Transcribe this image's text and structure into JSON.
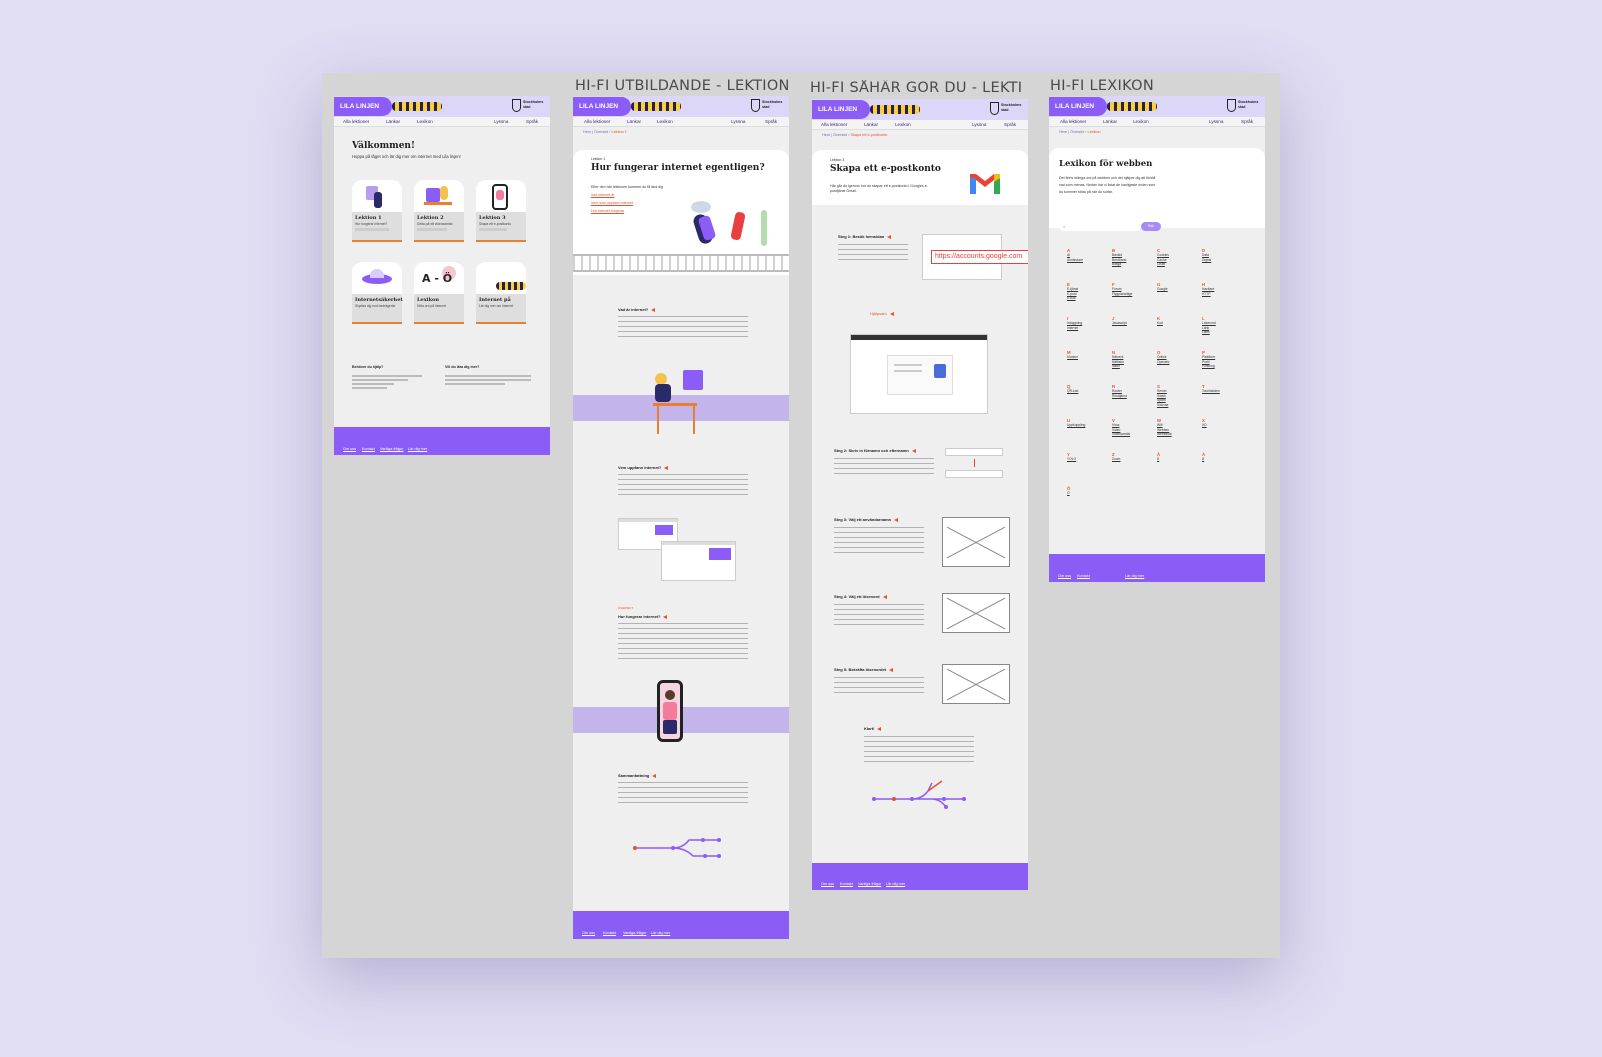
{
  "frame_titles": {
    "lektion": "HI-FI UTBILDANDE - LEKTION",
    "sahar": "HI-FI SÅHÄR GÖR DU - LEKTI...",
    "lexikon": "HI-FI LEXIKON"
  },
  "header": {
    "logo": "LILA LINJEN",
    "crest": "Stockholms stad"
  },
  "nav": {
    "lessons": "Alla lektioner",
    "links": "Länkar",
    "lexicon": "Lexikon",
    "listen": "Lyssna",
    "language": "Språk"
  },
  "home": {
    "title": "Välkommen!",
    "subtitle": "Hoppa på tåget och lär dig mer om internet med Lila linjen!",
    "cards": [
      {
        "title": "Lektion 1",
        "sub": "Hur fungerar internet?"
      },
      {
        "title": "Lektion 2",
        "sub": "Delta på ett videosamtal"
      },
      {
        "title": "Lektion 3",
        "sub": "Skapa ett e-postkonto"
      },
      {
        "title": "Internetsäkerhet",
        "sub": "Skydda dig mot bedrägerier"
      },
      {
        "title": "Lexikon",
        "sub": "Hitta ord på internet",
        "art": "A - Ö"
      },
      {
        "title": "Internet på",
        "sub": "Lär dig mer om internet"
      }
    ],
    "help_title": "Behöver du hjälp?",
    "about_title": "Vill du lära dig mer?"
  },
  "footer": {
    "om": "Om oss",
    "kontakt": "Kontakt",
    "questions": "Vanliga frågor",
    "path": "Lär dig mer"
  },
  "lektion": {
    "crumb": [
      "Hem",
      "Översikt",
      "Lektion 1"
    ],
    "kicker": "Lektion 1",
    "title": "Hur fungerar internet egentligen?",
    "intro": "Efter den här lektionen kommer du få lära dig",
    "links": [
      "Vad internet är",
      "Vem som uppfann internet",
      "Hur internet fungerar"
    ],
    "sections": [
      "Vad är internet?",
      "Vem uppfann internet?",
      "Hur fungerar internet?",
      "Sammanfattning"
    ],
    "label": "ÖVERSIKT"
  },
  "sahar": {
    "crumb": [
      "Hem",
      "Översikt",
      "Skapa ett e-postkonto"
    ],
    "kicker": "Lektion 3",
    "title": "Skapa ett e-postkonto",
    "intro": "Här går du igenom hur du skapar ett e-postkonto i Googles e-posttjänst Gmail.",
    "steps": [
      "Steg 1: Besök hemsidan",
      "Steg 2: Skriv in förnamn och efternamn",
      "Steg 3: Välj ett användarnamn",
      "Steg 4: Välj ett lösenord",
      "Steg 5: Bekräfta lösenordet",
      "Klart!"
    ],
    "url": "https://accounts.google.com",
    "tips": "Hjälpsam"
  },
  "lexikon": {
    "crumb": [
      "Hem",
      "Översikt",
      "Lexikon"
    ],
    "title": "Lexikon för webben",
    "intro": "Det finns många ord på webben och det hjälper dig att förstå vad som menas. Nedan har vi listat de vanligaste orden som du kommer stöta på när du surfar.",
    "search_button": "Sök",
    "letters": [
      {
        "l": "A",
        "w": [
          "AI",
          "Användare"
        ]
      },
      {
        "l": "B",
        "w": [
          "Bankid",
          "Bredband",
          "Bilaga"
        ]
      },
      {
        "l": "C",
        "w": [
          "Cookies",
          "Cache",
          "Chatt"
        ]
      },
      {
        "l": "D",
        "w": [
          "Data",
          "Digital"
        ]
      },
      {
        "l": "E",
        "w": [
          "E-tjänst",
          "E-post",
          "E-bok"
        ]
      },
      {
        "l": "F",
        "w": [
          "Forum",
          "Flygplansläge"
        ]
      },
      {
        "l": "G",
        "w": [
          "Google"
        ]
      },
      {
        "l": "H",
        "w": [
          "Hackare",
          "HTTP"
        ]
      },
      {
        "l": "I",
        "w": [
          "Inloggning",
          "Internet"
        ]
      },
      {
        "l": "J",
        "w": [
          "Javascript"
        ]
      },
      {
        "l": "K",
        "w": [
          "Kod"
        ]
      },
      {
        "l": "L",
        "w": [
          "Lösenord",
          "Länk",
          "Likes"
        ]
      },
      {
        "l": "M",
        "w": [
          "Modem"
        ]
      },
      {
        "l": "N",
        "w": [
          "Nätverk",
          "Nätfiske",
          "Nätet"
        ]
      },
      {
        "l": "O",
        "w": [
          "Online",
          "Operativ"
        ]
      },
      {
        "l": "P",
        "w": [
          "Plattform",
          "Profil",
          "Phishing"
        ]
      },
      {
        "l": "Q",
        "w": [
          "QR-kod"
        ]
      },
      {
        "l": "R",
        "w": [
          "Router",
          "Rösttjänst"
        ]
      },
      {
        "l": "S",
        "w": [
          "Server",
          "Swish",
          "Spam",
          "Sökruta"
        ]
      },
      {
        "l": "T",
        "w": [
          "Touchskärm"
        ]
      },
      {
        "l": "U",
        "w": [
          "Uppkoppling"
        ]
      },
      {
        "l": "V",
        "w": [
          "Virus",
          "Video",
          "Videosamtal"
        ]
      },
      {
        "l": "W",
        "w": [
          "Wifi",
          "Webben",
          "Webbsida"
        ]
      },
      {
        "l": "X",
        "w": [
          "XD"
        ]
      },
      {
        "l": "Y",
        "w": [
          "YOLO"
        ]
      },
      {
        "l": "Z",
        "w": [
          "Zoom"
        ]
      },
      {
        "l": "Å",
        "w": [
          "Å"
        ]
      },
      {
        "l": "Ä",
        "w": [
          "Ä"
        ]
      },
      {
        "l": "Ö",
        "w": [
          "Ö"
        ]
      }
    ]
  }
}
